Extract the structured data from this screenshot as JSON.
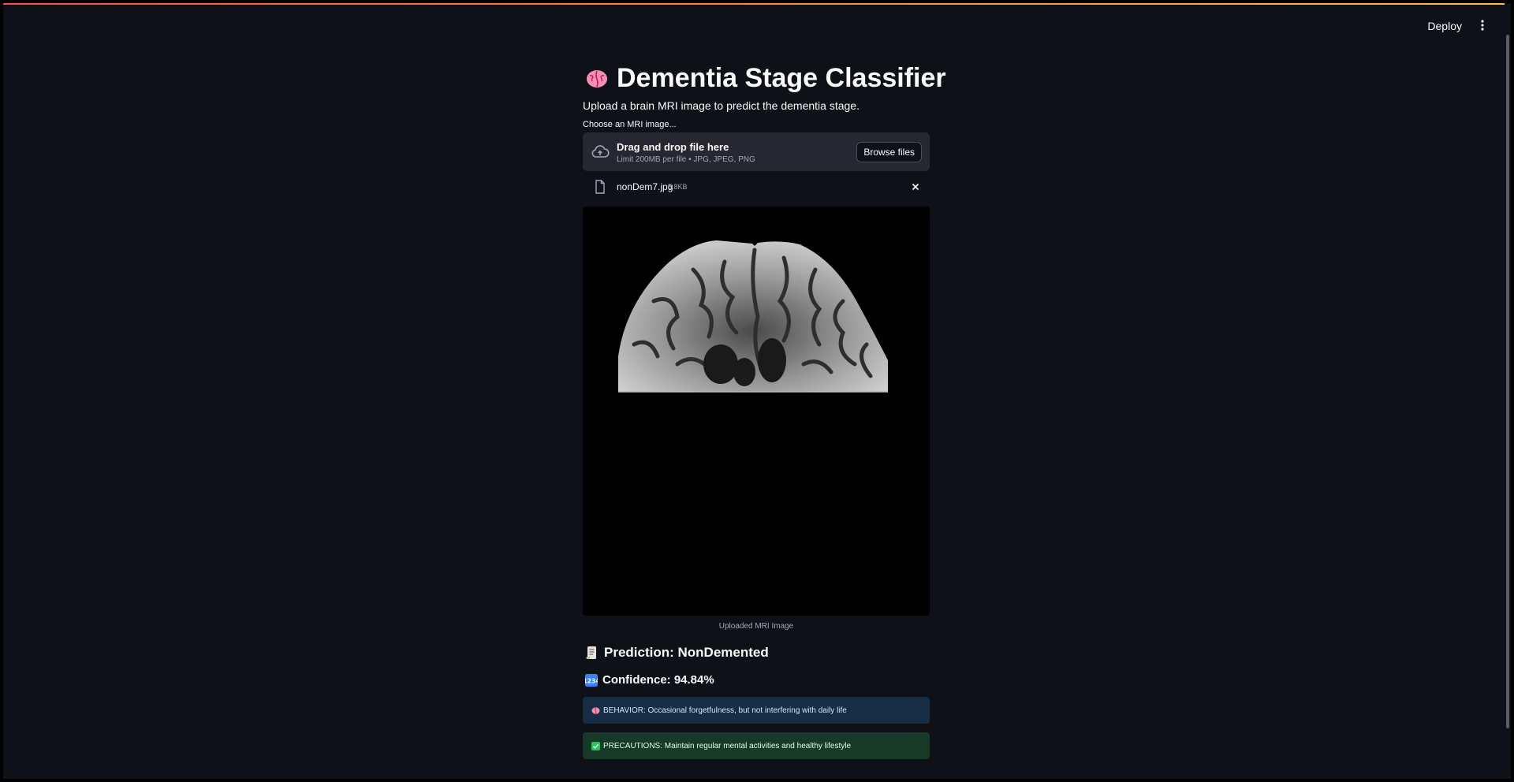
{
  "header": {
    "deploy_label": "Deploy",
    "menu_icon": "vertical-ellipsis-icon"
  },
  "page": {
    "title_icon": "brain-icon",
    "title": "Dementia Stage Classifier",
    "subtitle": "Upload a brain MRI image to predict the dementia stage."
  },
  "uploader": {
    "label": "Choose an MRI image...",
    "drop_title": "Drag and drop file here",
    "drop_limit": "Limit 200MB per file • JPG, JPEG, PNG",
    "browse_label": "Browse files",
    "upload_icon": "cloud-upload-icon"
  },
  "file": {
    "name": "nonDem7.jpg",
    "size": "5.8KB",
    "icon": "file-icon",
    "remove_icon": "close-icon"
  },
  "image": {
    "caption": "Uploaded MRI Image"
  },
  "result": {
    "prediction_icon": "scroll-icon",
    "prediction_text": "Prediction: NonDemented",
    "confidence_icon": "numbers-icon",
    "confidence_text": "Confidence: 94.84%"
  },
  "alerts": {
    "behavior_icon": "brain-icon",
    "behavior_text": "BEHAVIOR: Occasional forgetfulness, but not interfering with daily life",
    "behavior_color": "#172d43",
    "precautions_icon": "check-mark-icon",
    "precautions_text": "PRECAUTIONS: Maintain regular mental activities and healthy lifestyle",
    "precautions_color": "#173928"
  }
}
